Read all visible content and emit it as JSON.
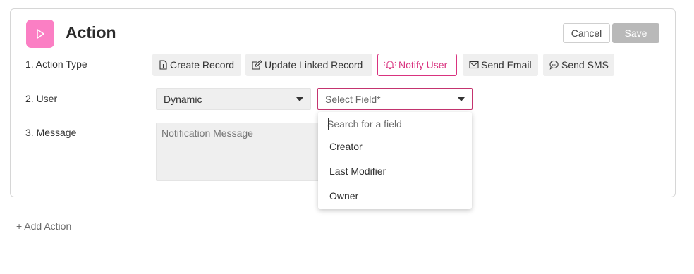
{
  "header": {
    "title": "Action",
    "cancel_label": "Cancel",
    "save_label": "Save"
  },
  "rows": {
    "action_type_label": "1. Action Type",
    "user_label": "2. User",
    "message_label": "3. Message"
  },
  "action_types": [
    {
      "label": "Create Record",
      "icon": "file-plus-icon"
    },
    {
      "label": "Update Linked Record",
      "icon": "edit-icon"
    },
    {
      "label": "Notify User",
      "icon": "bell-icon",
      "active": true
    },
    {
      "label": "Send Email",
      "icon": "mail-icon"
    },
    {
      "label": "Send SMS",
      "icon": "chat-icon"
    }
  ],
  "user": {
    "mode_value": "Dynamic",
    "field_placeholder": "Select Field*"
  },
  "message": {
    "placeholder": "Notification Message"
  },
  "field_dropdown": {
    "search_placeholder": "Search for a field",
    "options": [
      "Creator",
      "Last Modifier",
      "Owner"
    ]
  },
  "footer": {
    "add_action_label": "+ Add Action"
  },
  "colors": {
    "accent": "#d9337f",
    "badge": "#fb7fc4",
    "save_disabled": "#b9b9b9"
  }
}
